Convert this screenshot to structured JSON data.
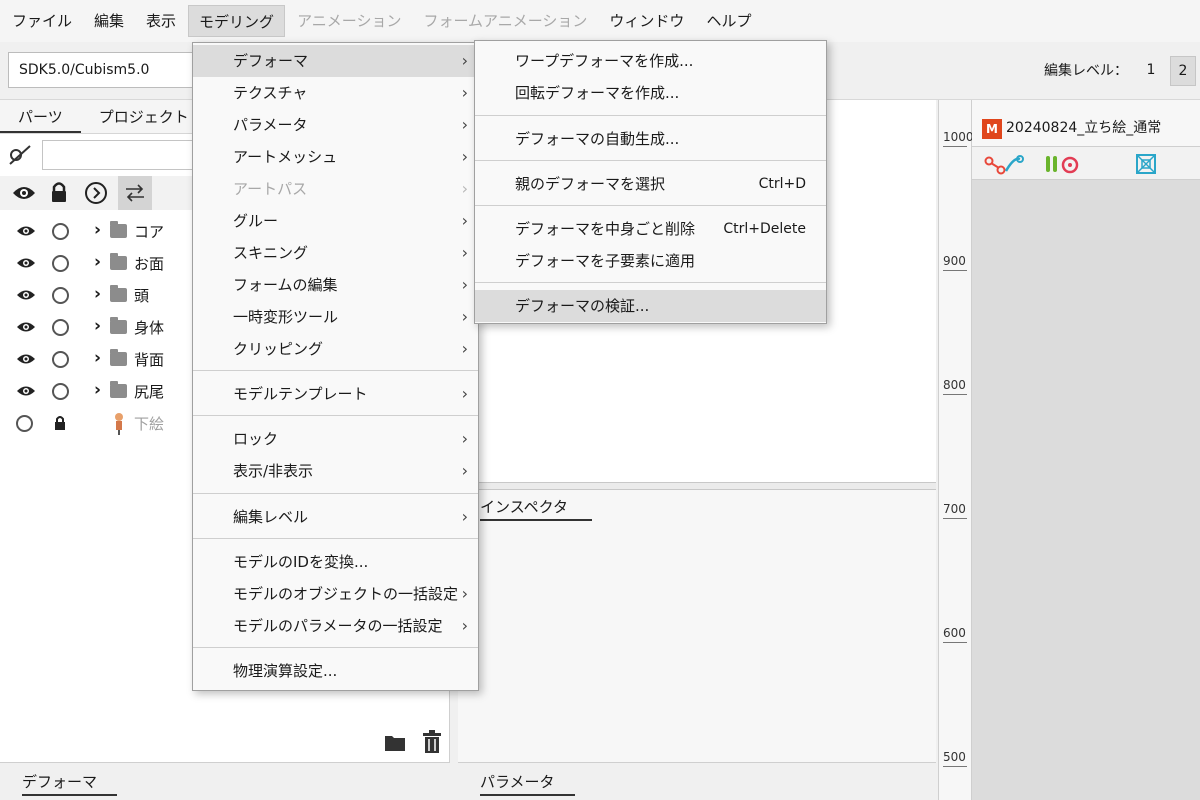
{
  "menubar": {
    "items": [
      {
        "label": "ファイル",
        "state": "normal"
      },
      {
        "label": "編集",
        "state": "normal"
      },
      {
        "label": "表示",
        "state": "normal"
      },
      {
        "label": "モデリング",
        "state": "active"
      },
      {
        "label": "アニメーション",
        "state": "disabled"
      },
      {
        "label": "フォームアニメーション",
        "state": "disabled"
      },
      {
        "label": "ウィンドウ",
        "state": "normal"
      },
      {
        "label": "ヘルプ",
        "state": "normal"
      }
    ]
  },
  "toolbar": {
    "sdk_select": "SDK5.0/Cubism5.0",
    "edit_level_label": "編集レベル：",
    "level_1": "1",
    "level_2": "2"
  },
  "left_panel": {
    "tabs": [
      "パーツ",
      "プロジェクト"
    ],
    "tree": [
      {
        "label": "コア"
      },
      {
        "label": "お面"
      },
      {
        "label": "頭"
      },
      {
        "label": "身体"
      },
      {
        "label": "背面"
      },
      {
        "label": "尻尾"
      },
      {
        "label": "下絵"
      }
    ]
  },
  "bottom": {
    "deformer_tab": "デフォーマ",
    "parameter_tab": "パラメータ"
  },
  "inspector": {
    "tab": "インスペクタ"
  },
  "ruler": {
    "ticks": [
      "1000",
      "900",
      "800",
      "700",
      "600",
      "500"
    ]
  },
  "viewport": {
    "doc_tab": "20240824_立ち絵_通常",
    "doc_icon": "M"
  },
  "main_menu": {
    "items": [
      {
        "label": "デフォーマ"
      },
      {
        "label": "テクスチャ"
      },
      {
        "label": "パラメータ"
      },
      {
        "label": "アートメッシュ"
      },
      {
        "label": "アートパス"
      },
      {
        "label": "グルー"
      },
      {
        "label": "スキニング"
      },
      {
        "label": "フォームの編集"
      },
      {
        "label": "一時変形ツール"
      },
      {
        "label": "クリッピング"
      },
      {
        "label": "モデルテンプレート"
      },
      {
        "label": "ロック"
      },
      {
        "label": "表示/非表示"
      },
      {
        "label": "編集レベル"
      },
      {
        "label": "モデルのIDを変換..."
      },
      {
        "label": "モデルのオブジェクトの一括設定"
      },
      {
        "label": "モデルのパラメータの一括設定"
      },
      {
        "label": "物理演算設定..."
      }
    ]
  },
  "sub_menu": {
    "items": [
      {
        "label": "ワープデフォーマを作成..."
      },
      {
        "label": "回転デフォーマを作成..."
      },
      {
        "label": "デフォーマの自動生成..."
      },
      {
        "label": "親のデフォーマを選択",
        "shortcut": "Ctrl+D"
      },
      {
        "label": "デフォーマを中身ごと削除",
        "shortcut": "Ctrl+Delete"
      },
      {
        "label": "デフォーマを子要素に適用"
      },
      {
        "label": "デフォーマの検証..."
      }
    ]
  }
}
